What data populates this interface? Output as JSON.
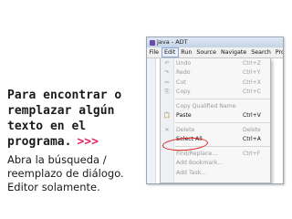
{
  "slide": {
    "title_lines": [
      "Para encontrar o",
      "remplazar algún",
      "texto en el",
      "programa."
    ],
    "arrows": ">>>",
    "description_lines": [
      "Abra la búsqueda /",
      "reemplazo de diálogo.",
      "Editor solamente."
    ]
  },
  "window": {
    "title": "Java - ADT",
    "menus": [
      "File",
      "Edit",
      "Run",
      "Source",
      "Navigate",
      "Search",
      "Pro"
    ],
    "active_menu": "Edit"
  },
  "edit_menu": {
    "items": [
      {
        "label": "Undo",
        "shortcut": "Ctrl+Z",
        "enabled": false,
        "icon": "undo-icon",
        "glyph": "↶"
      },
      {
        "label": "Redo",
        "shortcut": "Ctrl+Y",
        "enabled": false,
        "icon": "redo-icon",
        "glyph": "↷"
      },
      {
        "label": "Cut",
        "shortcut": "Ctrl+X",
        "enabled": false,
        "icon": "cut-icon",
        "glyph": "✂"
      },
      {
        "label": "Copy",
        "shortcut": "Ctrl+C",
        "enabled": false,
        "icon": "copy-icon",
        "glyph": "⎘"
      },
      {
        "label": "Copy Qualified Name",
        "shortcut": "",
        "enabled": false,
        "icon": "",
        "glyph": ""
      },
      {
        "label": "Paste",
        "shortcut": "Ctrl+V",
        "enabled": true,
        "icon": "paste-icon",
        "glyph": "📋"
      },
      {
        "label": "Delete",
        "shortcut": "Delete",
        "enabled": false,
        "icon": "delete-icon",
        "glyph": "✕"
      },
      {
        "label": "Select All",
        "shortcut": "Ctrl+A",
        "enabled": true,
        "icon": "",
        "glyph": ""
      },
      {
        "label": "Find/Replace...",
        "shortcut": "Ctrl+F",
        "enabled": false,
        "icon": "",
        "glyph": ""
      },
      {
        "label": "Add Bookmark...",
        "shortcut": "",
        "enabled": false,
        "icon": "",
        "glyph": ""
      },
      {
        "label": "Add Task...",
        "shortcut": "",
        "enabled": false,
        "icon": "",
        "glyph": ""
      }
    ]
  },
  "colors": {
    "accent_arrows": "#e0246a",
    "highlight_ring": "#e02020"
  }
}
